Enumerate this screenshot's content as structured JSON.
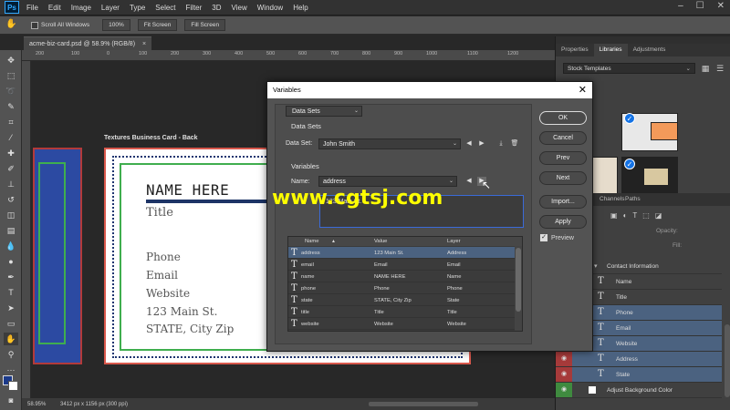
{
  "menubar": {
    "logo": "Ps",
    "items": [
      "File",
      "Edit",
      "Image",
      "Layer",
      "Type",
      "Select",
      "Filter",
      "3D",
      "View",
      "Window",
      "Help"
    ],
    "win_min": "–",
    "win_max": "☐",
    "win_close": "✕"
  },
  "options": {
    "scroll_all": "Scroll All Windows",
    "zoom": "100%",
    "fit": "Fit Screen",
    "fill": "Fill Screen"
  },
  "doc_tab": {
    "name": "acme-biz-card.psd @ 58.9% (RGB/8)",
    "close": "×"
  },
  "rulers": {
    "top_ticks": [
      "200",
      "100",
      "0",
      "100",
      "200",
      "300",
      "400",
      "500",
      "600",
      "700",
      "800",
      "900",
      "1000",
      "1100",
      "1200"
    ]
  },
  "canvas": {
    "artboard_label": "Textures Business Card - Back",
    "card": {
      "name": "NAME HERE",
      "title": "Title",
      "lines": [
        "Phone",
        "Email",
        "Website",
        "123 Main St.",
        "STATE, City Zip"
      ]
    }
  },
  "status": {
    "zoom": "58.95%",
    "doc_info": "3412 px x 1156 px (300 ppi)"
  },
  "right_panel": {
    "tabs": [
      "Properties",
      "Libraries",
      "Adjustments"
    ],
    "library_select": "Stock Templates",
    "layers_tabs": [
      "Channels",
      "Paths"
    ],
    "opacity_label": "Opacity:",
    "fill_label": "Fill:",
    "layers": [
      {
        "name": "Contact Information",
        "type": "folder",
        "eye": "",
        "selected": false
      },
      {
        "name": "Name",
        "type": "T",
        "eye": "",
        "selected": false
      },
      {
        "name": "Title",
        "type": "T",
        "eye": "",
        "selected": false
      },
      {
        "name": "Phone",
        "type": "T",
        "eye": "",
        "selected": true
      },
      {
        "name": "Email",
        "type": "T",
        "eye": "",
        "selected": true
      },
      {
        "name": "Website",
        "type": "T",
        "eye": "",
        "selected": true
      },
      {
        "name": "Address",
        "type": "T",
        "eye": "red",
        "selected": true
      },
      {
        "name": "State",
        "type": "T",
        "eye": "red",
        "selected": true
      },
      {
        "name": "Adjust Background Color",
        "type": "fill",
        "eye": "green",
        "selected": false
      }
    ]
  },
  "dialog": {
    "title": "Variables",
    "close": "✕",
    "mode_select": "Data Sets",
    "section_data_sets": "Data Sets",
    "data_set_label": "Data Set:",
    "data_set_value": "John Smith",
    "section_variables": "Variables",
    "name_label": "Name:",
    "name_value": "address",
    "value_text": "123 Main St.",
    "table": {
      "headers": [
        "Name",
        "Value",
        "Layer"
      ],
      "rows": [
        {
          "name": "address",
          "value": "123 Main St.",
          "layer": "Address",
          "selected": true
        },
        {
          "name": "email",
          "value": "Email",
          "layer": "Email",
          "selected": false
        },
        {
          "name": "name",
          "value": "NAME HERE",
          "layer": "Name",
          "selected": false
        },
        {
          "name": "phone",
          "value": "Phone",
          "layer": "Phone",
          "selected": false
        },
        {
          "name": "state",
          "value": "STATE, City Zip",
          "layer": "State",
          "selected": false
        },
        {
          "name": "title",
          "value": "Title",
          "layer": "Title",
          "selected": false
        },
        {
          "name": "website",
          "value": "Website",
          "layer": "Website",
          "selected": false
        }
      ]
    },
    "buttons": {
      "ok": "OK",
      "cancel": "Cancel",
      "prev": "Prev",
      "next": "Next",
      "import": "Import...",
      "apply": "Apply"
    },
    "preview_label": "Preview"
  },
  "watermark": "www.cgtsj.com"
}
